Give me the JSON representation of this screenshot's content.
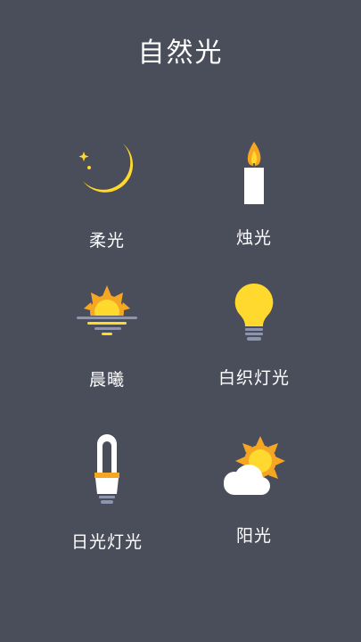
{
  "header": {
    "title": "自然光"
  },
  "modes": [
    {
      "label": "柔光",
      "icon": "moon-icon"
    },
    {
      "label": "烛光",
      "icon": "candle-icon"
    },
    {
      "label": "晨曦",
      "icon": "sunrise-icon"
    },
    {
      "label": "白织灯光",
      "icon": "light-bulb-icon"
    },
    {
      "label": "日光灯光",
      "icon": "fluorescent-lamp-icon"
    },
    {
      "label": "阳光",
      "icon": "sun-cloud-icon"
    }
  ],
  "colors": {
    "background": "#4a4e5a",
    "accent_yellow": "#ffd92e",
    "accent_orange": "#f5a623",
    "metal": "#8c94b0"
  }
}
